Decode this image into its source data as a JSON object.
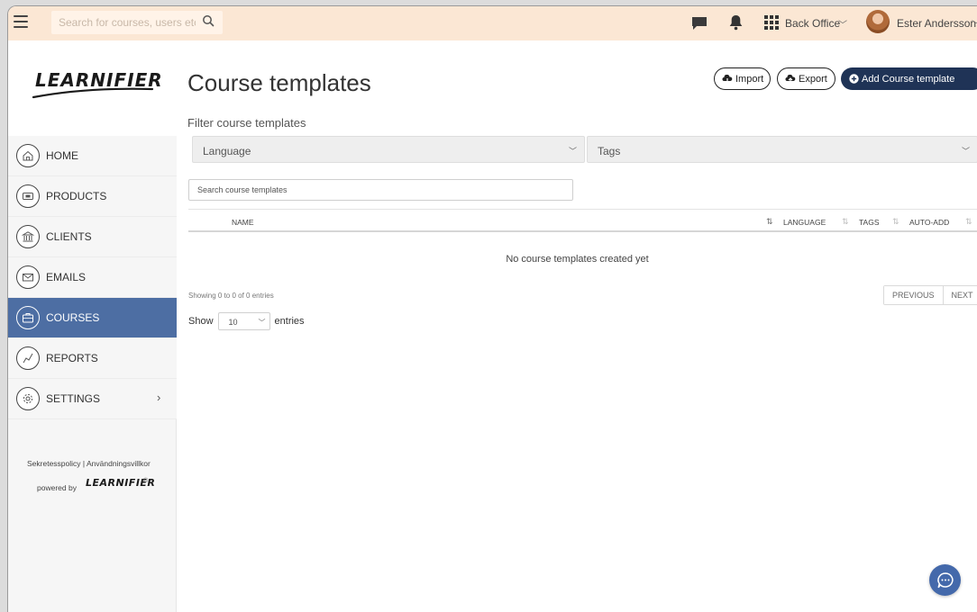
{
  "topbar": {
    "search_placeholder": "Search for courses, users etc.",
    "office": "Back Office",
    "user_name": "Ester Andersson",
    "icons": [
      "menu-icon",
      "search-icon",
      "chat-icon",
      "bell-icon",
      "apps-grid-icon",
      "chevron-down-icon"
    ]
  },
  "sidebar": {
    "logo": "LEARNIFIER",
    "items": [
      {
        "label": "HOME",
        "icon": "home-icon"
      },
      {
        "label": "PRODUCTS",
        "icon": "products-icon"
      },
      {
        "label": "CLIENTS",
        "icon": "bank-icon"
      },
      {
        "label": "EMAILS",
        "icon": "envelope-icon"
      },
      {
        "label": "COURSES",
        "icon": "briefcase-icon",
        "active": true
      },
      {
        "label": "REPORTS",
        "icon": "chart-line-icon"
      },
      {
        "label": "SETTINGS",
        "icon": "gear-icon",
        "has_submenu": true
      }
    ],
    "footer_links": "Sekretesspolicy | Användningsvillkor",
    "powered_by": "powered by",
    "powered_logo": "LEARNIFIER",
    "registered": "®",
    "submenu_arrow": "›"
  },
  "main": {
    "title": "Course templates",
    "import_label": "Import",
    "export_label": "Export",
    "add_label": "Add Course template",
    "filter_label": "Filter course templates",
    "language_filter": "Language",
    "tags_filter": "Tags",
    "search_placeholder": "Search course templates",
    "columns": [
      "NAME",
      "LANGUAGE",
      "TAGS",
      "AUTO-ADD"
    ],
    "empty_message": "No course templates created yet",
    "showing": "Showing 0 to 0 of 0 entries",
    "previous_label": "PREVIOUS",
    "next_label": "NEXT",
    "show_label": "Show",
    "page_size": "10",
    "entries_label": "entries"
  },
  "colors": {
    "topbar_bg": "#fbe7d4",
    "active_nav": "#4d6ea3",
    "primary_button": "#1f3356",
    "chat_fab": "#4469ab"
  }
}
